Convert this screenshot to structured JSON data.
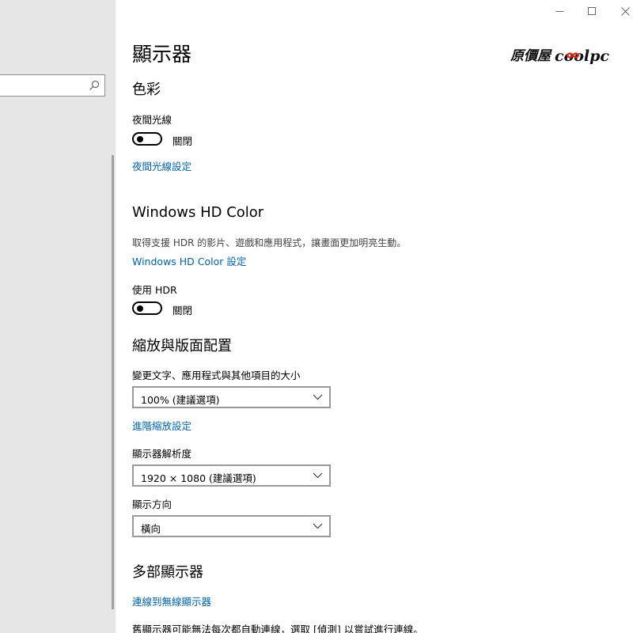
{
  "logo": {
    "text_prefix": "原價屋",
    "text_brand": "coolpc"
  },
  "page": {
    "title": "顯示器"
  },
  "color_section": {
    "title": "色彩",
    "night_light_label": "夜間光線",
    "night_light_state": "關閉",
    "night_light_link": "夜間光線設定"
  },
  "hd_color_section": {
    "title": "Windows HD Color",
    "description": "取得支援 HDR 的影片、遊戲和應用程式，讓畫面更加明亮生動。",
    "settings_link": "Windows HD Color 設定",
    "hdr_label": "使用 HDR",
    "hdr_state": "關閉"
  },
  "scale_section": {
    "title": "縮放與版面配置",
    "scale_label": "變更文字、應用程式與其他項目的大小",
    "scale_value": "100% (建議選項)",
    "advanced_link": "進階縮放設定",
    "resolution_label": "顯示器解析度",
    "resolution_value": "1920 × 1080 (建議選項)",
    "orientation_label": "顯示方向",
    "orientation_value": "橫向"
  },
  "multi_section": {
    "title": "多部顯示器",
    "wireless_link": "連線到無線顯示器",
    "note": "舊顯示器可能無法每次都自動連線，選取 [偵測] 以嘗試進行連線。"
  },
  "colors": {
    "link": "#0063b1",
    "nav_background": "#e6e6e6",
    "logo_red": "#d7261c"
  }
}
